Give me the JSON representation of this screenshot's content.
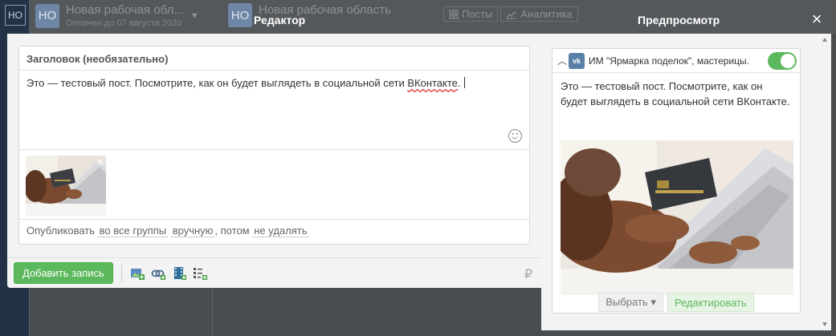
{
  "background": {
    "left_badge": "НО",
    "workspace1": {
      "avatar": "НО",
      "name": "Новая рабочая обл...",
      "subtitle": "Оплачен до 07 августа 2020"
    },
    "workspace2": {
      "avatar": "НО",
      "name": "Новая рабочая область"
    },
    "tabs": [
      {
        "label": "Посты",
        "icon": "grid-icon"
      },
      {
        "label": "Аналитика",
        "icon": "chart-icon"
      }
    ]
  },
  "modal": {
    "editor_title": "Редактор",
    "preview_title": "Предпросмотр",
    "close_label": "×"
  },
  "editor": {
    "title_placeholder": "Заголовок (необязательно)",
    "text_before": "Это — тестовый пост. Посмотрите, как он будет выглядеть в социальной сети ",
    "text_misspelled": "ВКонтакте",
    "text_after": ".",
    "thumb_remove": "×",
    "publish": {
      "prefix": "Опубликовать",
      "groups": "во все группы",
      "mode": "вручную",
      "then": ", потом",
      "delete": "не удалять"
    },
    "add_button": "Добавить запись",
    "ruble_symbol": "₽",
    "toolbar_icons": [
      "add-image-icon",
      "attach-link-icon",
      "add-video-icon",
      "add-poll-icon"
    ]
  },
  "preview": {
    "vk_badge": "vk",
    "group_name": "ИМ \"Ярмарка поделок\", мастерицы.",
    "enabled": true,
    "text": "Это — тестовый пост. Посмотрите, как он будет выглядеть в социальной сети ВКонтакте.",
    "select_button": "Выбрать ▾",
    "edit_button": "Редактировать"
  },
  "colors": {
    "accent_green": "#5cb85c",
    "vk_blue": "#5a7fa8"
  }
}
